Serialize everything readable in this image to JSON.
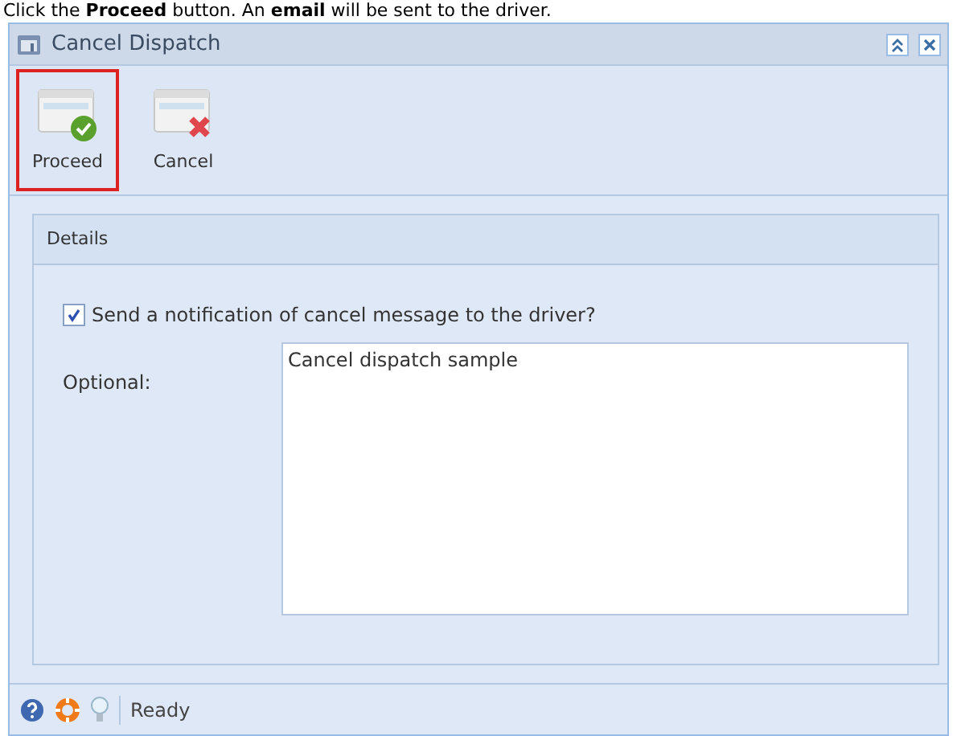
{
  "caption": "Click the **Proceed** button. An **email** will be sent to the driver.",
  "window": {
    "title": "Cancel Dispatch"
  },
  "toolbar": [
    {
      "label": "Proceed",
      "kind": "proceed",
      "selected": true
    },
    {
      "label": "Cancel",
      "kind": "cancel",
      "selected": false
    }
  ],
  "panel": {
    "title": "Details",
    "checkbox": {
      "label": "Send a notification of cancel message to the driver?",
      "checked": true
    },
    "field": {
      "label": "Optional:",
      "value": "Cancel dispatch sample"
    }
  },
  "status_bar": {
    "text": "Ready"
  }
}
